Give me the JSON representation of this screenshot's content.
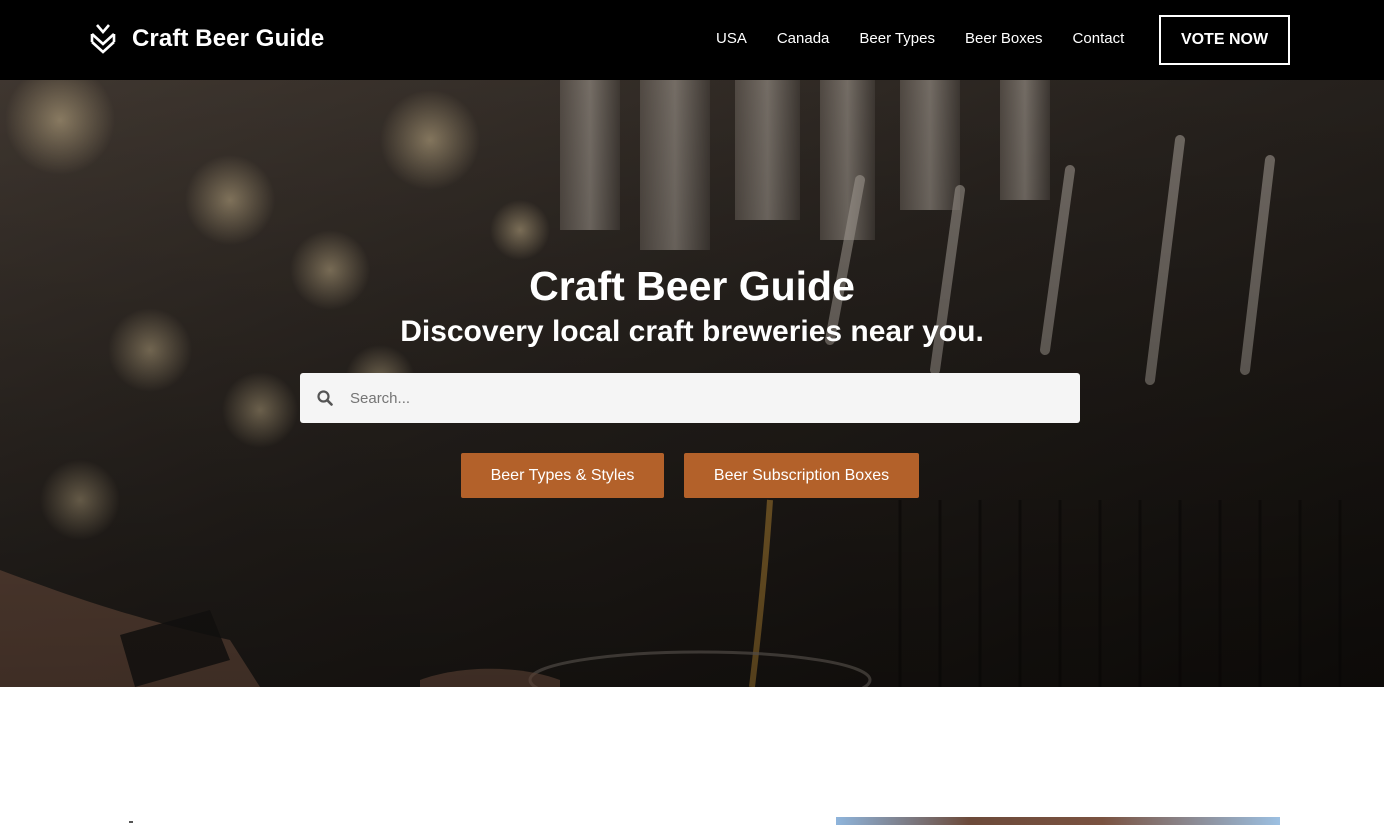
{
  "header": {
    "logo_icon": "wheat-chevron-icon",
    "site_name": "Craft Beer Guide",
    "nav": [
      {
        "label": "USA"
      },
      {
        "label": "Canada"
      },
      {
        "label": "Beer Types"
      },
      {
        "label": "Beer Boxes"
      },
      {
        "label": "Contact"
      }
    ],
    "vote_button": "VOTE NOW"
  },
  "hero": {
    "title": "Craft Beer Guide",
    "subtitle": "Discovery local craft breweries near you.",
    "search": {
      "icon": "search-icon",
      "placeholder": "Search...",
      "value": ""
    },
    "buttons": [
      {
        "label": "Beer Types & Styles"
      },
      {
        "label": "Beer Subscription Boxes"
      }
    ]
  },
  "colors": {
    "header_bg": "#000000",
    "button_bg": "#b3612a",
    "search_bg": "#f5f5f5",
    "text_light": "#ffffff"
  }
}
